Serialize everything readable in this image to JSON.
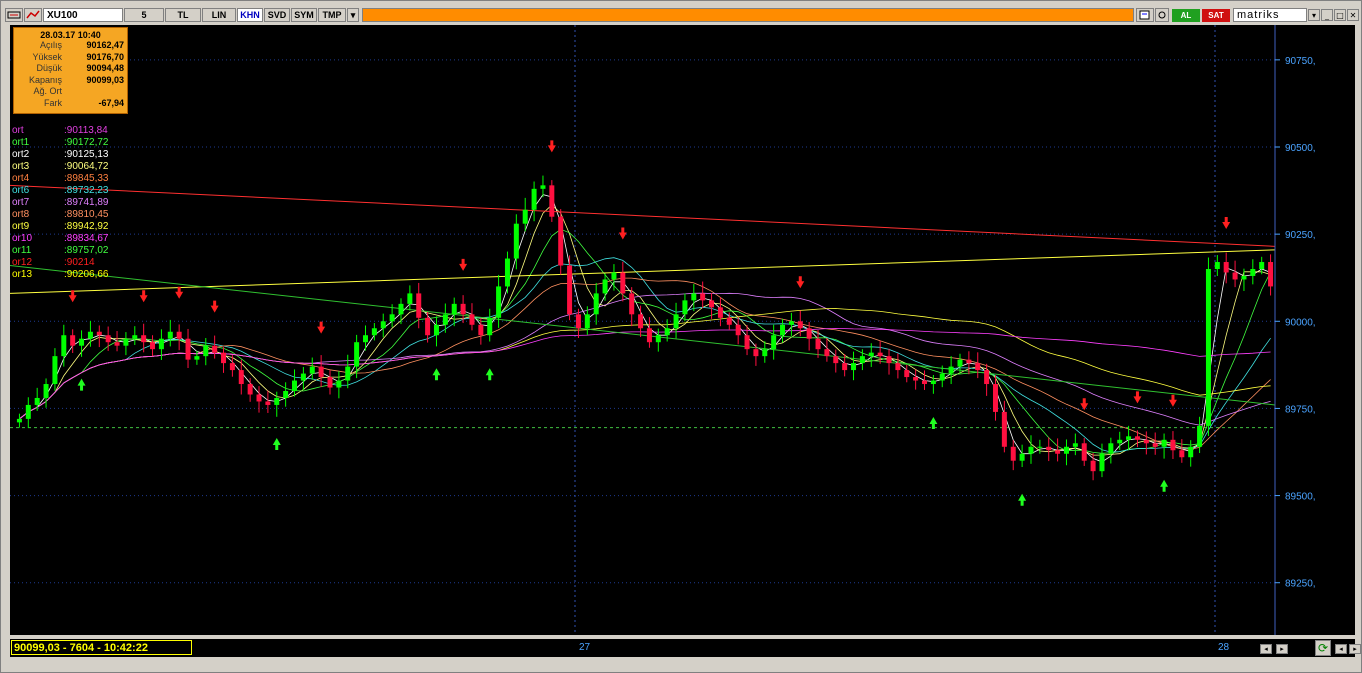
{
  "toolbar": {
    "symbol": "XU100",
    "period": "5",
    "buttons": [
      "TL",
      "LIN",
      "KHN",
      "SVD",
      "SYM",
      "TMP"
    ],
    "active_button": "KHN",
    "buy_label": "AL",
    "sell_label": "SAT",
    "brand": "matriks"
  },
  "info_box": {
    "datetime": "28.03.17 10:40",
    "rows": [
      {
        "label": "Açılış",
        "value": "90162,47"
      },
      {
        "label": "Yüksek",
        "value": "90176,70"
      },
      {
        "label": "Düşük",
        "value": "90094,48"
      },
      {
        "label": "Kapanış",
        "value": "90099,03"
      },
      {
        "label": "Ağ. Ort",
        "value": ""
      },
      {
        "label": "Fark",
        "value": "-67,94"
      }
    ]
  },
  "legend": [
    {
      "name": "ort",
      "value": ":90113,84",
      "color": "#e040e0"
    },
    {
      "name": "ort1",
      "value": ":90172,72",
      "color": "#40ff40"
    },
    {
      "name": "ort2",
      "value": ":90125,13",
      "color": "#ffffff"
    },
    {
      "name": "ort3",
      "value": ":90064,72",
      "color": "#ffff80"
    },
    {
      "name": "ort4",
      "value": ":89845,33",
      "color": "#ff8040"
    },
    {
      "name": "ort6",
      "value": ":89732,23",
      "color": "#40e0e0"
    },
    {
      "name": "ort7",
      "value": ":89741,89",
      "color": "#e080ff"
    },
    {
      "name": "ort8",
      "value": ":89810,45",
      "color": "#ff9060"
    },
    {
      "name": "ort9",
      "value": ":89942,92",
      "color": "#ffff40"
    },
    {
      "name": "or10",
      "value": ":89834,67",
      "color": "#ff40ff"
    },
    {
      "name": "or11",
      "value": ":89757,02",
      "color": "#40ff40"
    },
    {
      "name": "or12",
      "value": ":90214",
      "color": "#ff2020"
    },
    {
      "name": "or13",
      "value": ":90206,66",
      "color": "#ffff00"
    }
  ],
  "y_axis": {
    "ticks": [
      "90750,",
      "90500,",
      "90250,",
      "90000,",
      "89750,",
      "89500,",
      "89250,"
    ]
  },
  "x_axis": {
    "day_labels": [
      "27",
      "28"
    ]
  },
  "status": {
    "readout": "90099,03 - 7604 - 10:42:22"
  },
  "colors": {
    "background": "#000000",
    "up_candle": "#00ff00",
    "down_candle": "#ff1040",
    "axis_text": "#4aa3ff",
    "grid": "#1a3a8a"
  },
  "chart_data": {
    "type": "line",
    "title": "",
    "ylim": [
      89100,
      90850
    ],
    "y_ticks": [
      90750,
      90500,
      90250,
      90000,
      89750,
      89500,
      89250
    ],
    "close_series": [
      89720,
      89760,
      89780,
      89820,
      89900,
      89960,
      89930,
      89950,
      89970,
      89960,
      89940,
      89930,
      89950,
      89960,
      89940,
      89920,
      89950,
      89970,
      89950,
      89890,
      89900,
      89930,
      89910,
      89880,
      89860,
      89820,
      89790,
      89770,
      89760,
      89780,
      89800,
      89830,
      89850,
      89870,
      89840,
      89810,
      89830,
      89870,
      89940,
      89960,
      89980,
      90000,
      90020,
      90050,
      90080,
      90010,
      89960,
      89990,
      90020,
      90050,
      90020,
      89990,
      89960,
      90010,
      90100,
      90180,
      90280,
      90320,
      90380,
      90390,
      90300,
      90160,
      90020,
      89980,
      90020,
      90080,
      90120,
      90140,
      90080,
      90020,
      89980,
      89940,
      89960,
      89980,
      90020,
      90060,
      90080,
      90060,
      90040,
      90010,
      89990,
      89960,
      89920,
      89900,
      89920,
      89960,
      89990,
      90000,
      89980,
      89950,
      89920,
      89900,
      89880,
      89860,
      89880,
      89900,
      89910,
      89900,
      89880,
      89860,
      89840,
      89830,
      89820,
      89830,
      89850,
      89870,
      89890,
      89880,
      89860,
      89820,
      89740,
      89640,
      89600,
      89620,
      89640,
      89640,
      89630,
      89620,
      89640,
      89650,
      89600,
      89570,
      89620,
      89650,
      89660,
      89670,
      89660,
      89650,
      89640,
      89660,
      89630,
      89610,
      89640,
      89700,
      90150,
      90170,
      90140,
      90120,
      90130,
      90150,
      90170,
      90100
    ]
  }
}
